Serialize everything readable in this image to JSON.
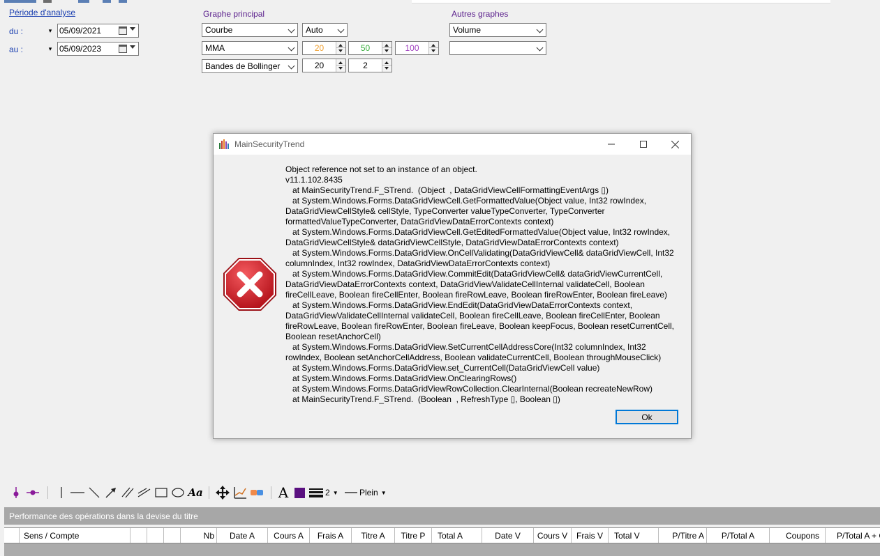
{
  "analysis": {
    "title": "Période d'analyse",
    "from_label": "du :",
    "to_label": "au :",
    "from_date": "05/09/2021",
    "to_date": "05/09/2023"
  },
  "main_graph": {
    "title": "Graphe principal",
    "chart_type": "Courbe",
    "scale": "Auto",
    "indicator1": "MMA",
    "mma_values": [
      "20",
      "50",
      "100"
    ],
    "indicator2": "Bandes de Bollinger",
    "bollinger_values": [
      "20",
      "2"
    ]
  },
  "other_graphs": {
    "title": "Autres graphes",
    "graph1": "Volume",
    "graph2": ""
  },
  "dialog": {
    "title": "MainSecurityTrend",
    "message": "Object reference not set to an instance of an object.\nv11.1.102.8435\n   at MainSecurityTrend.F_STrend.  (Object  , DataGridViewCellFormattingEventArgs ▯)\n   at System.Windows.Forms.DataGridViewCell.GetFormattedValue(Object value, Int32 rowIndex,\nDataGridViewCellStyle& cellStyle, TypeConverter valueTypeConverter, TypeConverter\nformattedValueTypeConverter, DataGridViewDataErrorContexts context)\n   at System.Windows.Forms.DataGridViewCell.GetEditedFormattedValue(Object value, Int32 rowIndex,\nDataGridViewCellStyle& dataGridViewCellStyle, DataGridViewDataErrorContexts context)\n   at System.Windows.Forms.DataGridView.OnCellValidating(DataGridViewCell& dataGridViewCell, Int32\ncolumnIndex, Int32 rowIndex, DataGridViewDataErrorContexts context)\n   at System.Windows.Forms.DataGridView.CommitEdit(DataGridViewCell& dataGridViewCurrentCell,\nDataGridViewDataErrorContexts context, DataGridViewValidateCellInternal validateCell, Boolean\nfireCellLeave, Boolean fireCellEnter, Boolean fireRowLeave, Boolean fireRowEnter, Boolean fireLeave)\n   at System.Windows.Forms.DataGridView.EndEdit(DataGridViewDataErrorContexts context,\nDataGridViewValidateCellInternal validateCell, Boolean fireCellLeave, Boolean fireCellEnter, Boolean\nfireRowLeave, Boolean fireRowEnter, Boolean fireLeave, Boolean keepFocus, Boolean resetCurrentCell,\nBoolean resetAnchorCell)\n   at System.Windows.Forms.DataGridView.SetCurrentCellAddressCore(Int32 columnIndex, Int32\nrowIndex, Boolean setAnchorCellAddress, Boolean validateCurrentCell, Boolean throughMouseClick)\n   at System.Windows.Forms.DataGridView.set_CurrentCell(DataGridViewCell value)\n   at System.Windows.Forms.DataGridView.OnClearingRows()\n   at System.Windows.Forms.DataGridViewRowCollection.ClearInternal(Boolean recreateNewRow)\n   at MainSecurityTrend.F_STrend.  (Boolean  , RefreshType ▯, Boolean ▯)",
    "ok_label": "Ok"
  },
  "toolbar": {
    "line_width": "2",
    "line_style": "Plein",
    "font_glyph": "A",
    "text_glyph": "Aa"
  },
  "grid": {
    "title": "Performance des opérations dans la devise du titre",
    "columns": [
      "Sens / Compte",
      "",
      "",
      "",
      "Nb",
      "Date A",
      "Cours A",
      "Frais A",
      "Titre A",
      "Titre P",
      "Total A",
      "Date V",
      "Cours V",
      "Frais V",
      "Total V",
      "P/Titre A",
      "P/Total A",
      "Coupons",
      "P/Total A + C"
    ]
  },
  "colors": {
    "mma_short": "#f0a030",
    "mma_medium": "#3cb040",
    "mma_long": "#a040c0",
    "toolbar_purple": "#5a1080",
    "ok_border": "#0078d7",
    "error_red": "#d8222c"
  }
}
